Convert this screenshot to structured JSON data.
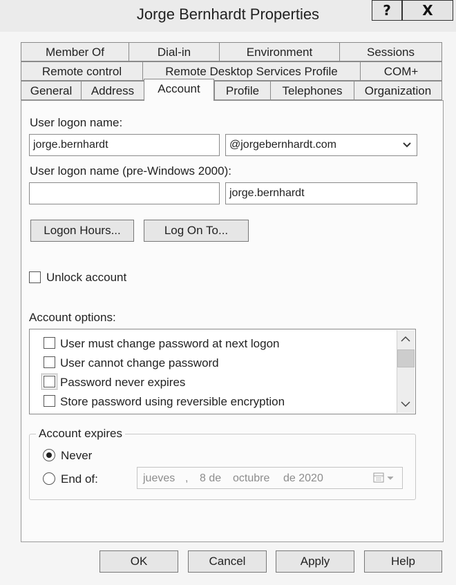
{
  "window": {
    "title": "Jorge Bernhardt Properties",
    "help_button": "?",
    "close_button": "X"
  },
  "tabs": {
    "row1": [
      "Member Of",
      "Dial-in",
      "Environment",
      "Sessions"
    ],
    "row2": [
      "Remote control",
      "Remote Desktop Services Profile",
      "COM+"
    ],
    "row3": [
      "General",
      "Address",
      "Account",
      "Profile",
      "Telephones",
      "Organization"
    ],
    "active": "Account"
  },
  "account": {
    "user_logon_label": "User logon name:",
    "user_logon_value": "jorge.bernhardt",
    "domain_suffix": "@jorgebernhardt.com",
    "pre2000_label": "User logon name (pre-Windows 2000):",
    "pre2000_domain": "",
    "pre2000_user": "jorge.bernhardt",
    "logon_hours_button": "Logon Hours...",
    "log_on_to_button": "Log On To...",
    "unlock_label": "Unlock account",
    "unlock_checked": false,
    "options_label": "Account options:",
    "options": [
      {
        "label": "User must change password at next logon",
        "checked": false
      },
      {
        "label": "User cannot change password",
        "checked": false
      },
      {
        "label": "Password never expires",
        "checked": false
      },
      {
        "label": "Store password using reversible encryption",
        "checked": false
      }
    ],
    "expires": {
      "group_label": "Account expires",
      "never_label": "Never",
      "never_selected": true,
      "end_of_label": "End of:",
      "date": {
        "weekday": "jueves",
        "sep": ",",
        "day": "8 de",
        "month": "octubre",
        "year": "de 2020"
      }
    }
  },
  "footer": {
    "ok": "OK",
    "cancel": "Cancel",
    "apply": "Apply",
    "help": "Help"
  },
  "icons": {
    "dropdown": "chevron-down-icon",
    "scroll_up": "scroll-up-icon",
    "scroll_down": "scroll-down-icon",
    "calendar": "calendar-icon"
  },
  "colors": {
    "background": "#f5f5f5",
    "panel": "#fbfbfb",
    "border": "#8a8a8a"
  }
}
